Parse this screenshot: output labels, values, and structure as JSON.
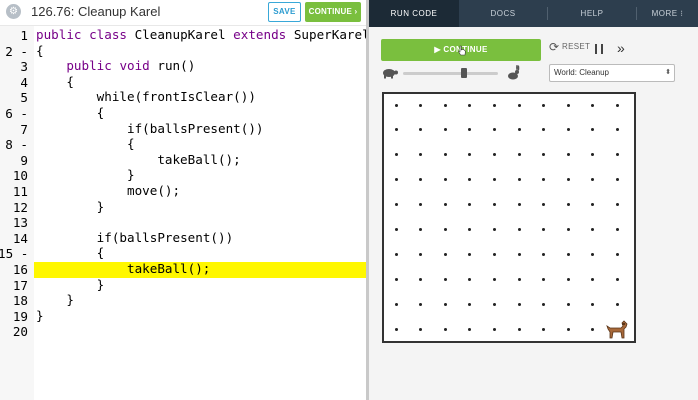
{
  "editor": {
    "title": "126.76: Cleanup Karel",
    "title_icon": "gear-icon",
    "save_label": "SAVE",
    "continue_label": "CONTINUE ›",
    "highlighted_line": 16,
    "line_numbers": [
      "1",
      "2 -",
      "3",
      "4",
      "5",
      "6 -",
      "7",
      "8 -",
      "9",
      "10",
      "11",
      "12",
      "13",
      "14",
      "15 -",
      "16",
      "17",
      "18",
      "19",
      "20"
    ],
    "lines": [
      "public class CleanupKarel extends SuperKarel",
      "{",
      "    public void run()",
      "    {",
      "        while(frontIsClear())",
      "        {",
      "            if(ballsPresent())",
      "            {",
      "                takeBall();",
      "            }",
      "            move();",
      "        }",
      "",
      "        if(ballsPresent())",
      "        {",
      "            takeBall();",
      "        }",
      "    }",
      "}",
      ""
    ]
  },
  "runner": {
    "tabs": [
      "RUN CODE",
      "DOCS",
      "HELP",
      "MORE ⁝"
    ],
    "active_tab": "RUN CODE",
    "run_button": "▶  CONTINUE",
    "reset_label": "RESET",
    "speed_percent": 64,
    "world_select": "World: Cleanup",
    "world_rows": 10,
    "world_cols": 10,
    "karel_position": {
      "row": 10,
      "col": 10
    }
  },
  "colors": {
    "accent_green": "#7abf3e",
    "nav_bg": "#2d3e4e",
    "highlight": "#fff700"
  }
}
